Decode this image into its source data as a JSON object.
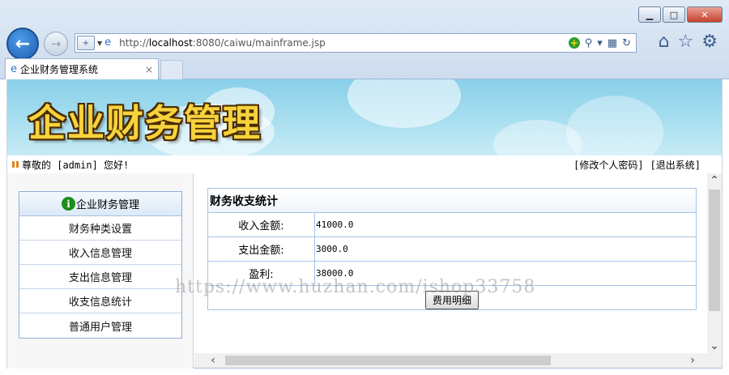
{
  "browser": {
    "url_prefix": "http://",
    "url_host": "localhost",
    "url_rest": ":8080/caiwu/mainframe.jsp",
    "tab_title": "企业财务管理系统",
    "tab_close": "×",
    "window_controls": {
      "minimize": "▁",
      "maximize": "□",
      "close": "✕"
    },
    "icons": [
      "back-icon",
      "forward-icon",
      "home-icon",
      "favorites-star-icon",
      "settings-gear-icon"
    ]
  },
  "banner": {
    "title": "企业财务管理"
  },
  "userbar": {
    "greeting": "尊敬的 [admin] 您好!",
    "change_password": "[修改个人密码]",
    "logout": "[退出系统]"
  },
  "sidebar": {
    "header": "企业财务管理",
    "items": [
      {
        "label": "财务种类设置"
      },
      {
        "label": "收入信息管理"
      },
      {
        "label": "支出信息管理"
      },
      {
        "label": "收支信息统计"
      },
      {
        "label": "普通用户管理"
      }
    ]
  },
  "stats": {
    "caption": "财务收支统计",
    "rows": [
      {
        "label": "收入金额:",
        "value": "41000.0"
      },
      {
        "label": "支出金额:",
        "value": "3000.0"
      },
      {
        "label": "盈利:",
        "value": "38000.0"
      }
    ],
    "button": "费用明细"
  },
  "watermark": "https://www.huzhan.com/ishop33758",
  "colors": {
    "banner_title": "#f6d33c",
    "accent": "#1b5fb4",
    "menu_border": "#8fb0d6"
  }
}
